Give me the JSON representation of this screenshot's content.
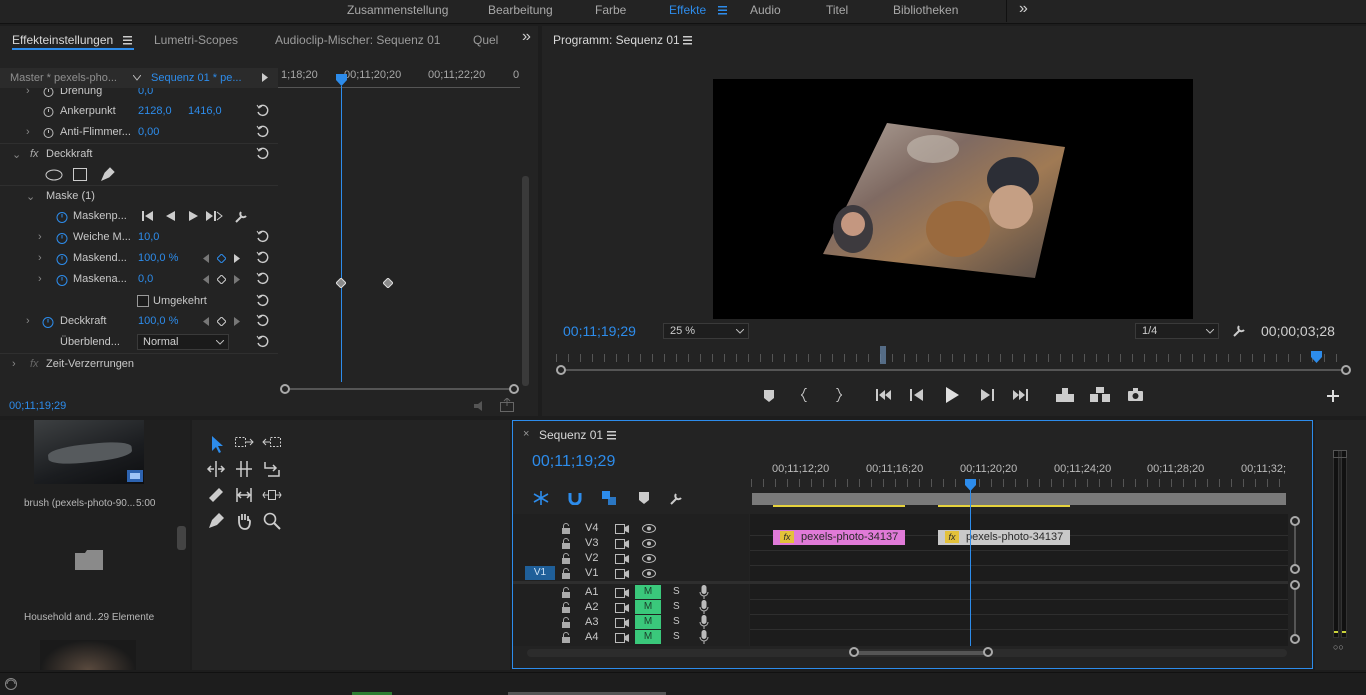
{
  "workspaces": [
    {
      "label": "Zusammenstellung",
      "active": false
    },
    {
      "label": "Bearbeitung",
      "active": false
    },
    {
      "label": "Farbe",
      "active": false
    },
    {
      "label": "Effekte",
      "active": true
    },
    {
      "label": "Audio",
      "active": false
    },
    {
      "label": "Titel",
      "active": false
    },
    {
      "label": "Bibliotheken",
      "active": false
    }
  ],
  "workspace_more": "»",
  "source_panel": {
    "tabs": [
      "Effekteinstellungen",
      "Lumetri-Scopes",
      "Audioclip-Mischer: Sequenz 01",
      "Quel"
    ],
    "more": "»",
    "master_clip": "Master * pexels-pho...",
    "sequence_clip": "Sequenz 01 * pe...",
    "ruler": [
      "1;18;20",
      "00;11;20;20",
      "00;11;22;20",
      "0"
    ],
    "timecode": "00;11;19;29"
  },
  "effects": {
    "drehung": {
      "label": "Drehung",
      "value": "0,0"
    },
    "ankerpunkt": {
      "label": "Ankerpunkt",
      "x": "2128,0",
      "y": "1416,0"
    },
    "antiflimmer": {
      "label": "Anti-Flimmer...",
      "value": "0,00"
    },
    "deckkraft_section": "Deckkraft",
    "maske": "Maske (1)",
    "maskenpfad": "Maskenp...",
    "weiche": {
      "label": "Weiche M...",
      "value": "10,0"
    },
    "maskendeck": {
      "label": "Maskend...",
      "value": "100,0 %"
    },
    "maskenausw": {
      "label": "Maskena...",
      "value": "0,0"
    },
    "umgekehrt": "Umgekehrt",
    "deckkraft": {
      "label": "Deckkraft",
      "value": "100,0 %"
    },
    "ueberblend": {
      "label": "Überblend...",
      "value": "Normal"
    },
    "zeit": "Zeit-Verzerrungen",
    "fx": "fx"
  },
  "program": {
    "title": "Programm: Sequenz 01",
    "timecode": "00;11;19;29",
    "zoom": "25 %",
    "resolution": "1/4",
    "duration": "00;00;03;28"
  },
  "project": {
    "item1": {
      "name": "brush (pexels-photo-90...",
      "duration": "5:00"
    },
    "item2": {
      "name": "Household and...",
      "count": "29 Elemente"
    }
  },
  "timeline": {
    "title": "Sequenz 01",
    "timecode": "00;11;19;29",
    "ruler": [
      "00;11;12;20",
      "00;11;16;20",
      "00;11;20;20",
      "00;11;24;20",
      "00;11;28;20",
      "00;11;32;"
    ],
    "video_tracks": [
      "V4",
      "V3",
      "V2",
      "V1"
    ],
    "audio_tracks": [
      "A1",
      "A2",
      "A3",
      "A4"
    ],
    "source_patch": "V1",
    "m_label": "M",
    "s_label": "S",
    "clips": [
      {
        "name": "pexels-photo-34137",
        "fx": "fx",
        "color": "#e07ad8"
      },
      {
        "name": "pexels-photo-34137",
        "fx": "fx",
        "color": "#c9c9c9"
      }
    ]
  },
  "colors": {
    "accent": "#2d8ceb",
    "mute_green": "#3ac87b",
    "clip_pink": "#e07ad8",
    "work_area_yellow": "#e6d23c"
  }
}
